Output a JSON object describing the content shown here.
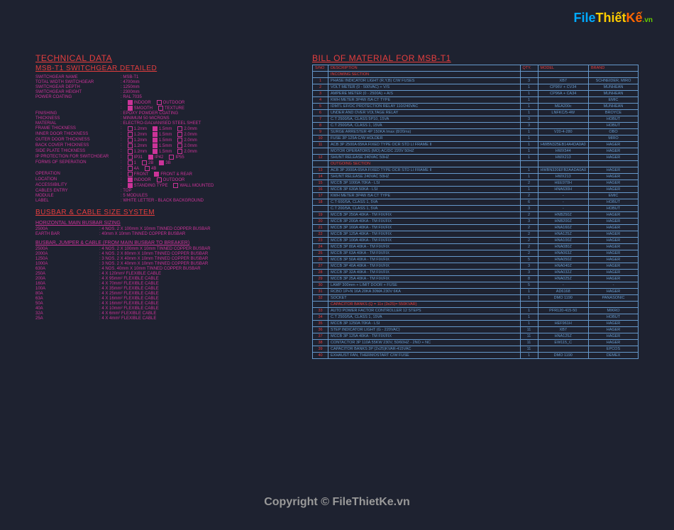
{
  "logo": {
    "part1": "File",
    "part2": "Thiết",
    "part3": "Kế",
    "suffix": ".vn"
  },
  "watermark": "Copyright © FileThietKe.vn",
  "left": {
    "h1": "TECHNICAL DATA",
    "h2": "MSB-T1 SWITCHGEAR DETAILED",
    "specs": [
      {
        "label": "SWITCHGEAR NAME",
        "value": ": MSB-T1"
      },
      {
        "label": "TOTAL WIDTH SWITCHGEAR",
        "value": ": 4700mm"
      },
      {
        "label": "SWITCHGEAR DEPTH",
        "value": ": 1250mm"
      },
      {
        "label": "SWITCHGEAR HEIGHT",
        "value": ": 2300mm"
      },
      {
        "label": "POWER COATING",
        "value": ": RAL 7035"
      }
    ],
    "finishing_label": "FINISHING",
    "finishing_value": ": EPOXY POWDER COATING",
    "thickness_label": "THICKNESS",
    "thickness_value": ": MINIMUM 50 MICRONS",
    "material_label": "MATERIAL",
    "material_value": ": ELECTRO-GALVANISED STEEL SHEET",
    "thickspec": [
      {
        "label": "FRAME THICKNESS",
        "opts": [
          "1.2mm",
          "1.5mm",
          "2.0mm"
        ]
      },
      {
        "label": "INNER DOOR THICKNESS",
        "opts": [
          "1.2mm",
          "1.5mm",
          "2.0mm"
        ]
      },
      {
        "label": "OUTER DOOR THICKNESS",
        "opts": [
          "1.2mm",
          "1.5mm",
          "2.0mm"
        ]
      },
      {
        "label": "BACK COVER THICKNESS",
        "opts": [
          "1.2mm",
          "1.5mm",
          "2.0mm"
        ]
      },
      {
        "label": "SIDE PLATE THICKNESS",
        "opts": [
          "1.2mm",
          "1.5mm",
          "2.0mm"
        ]
      }
    ],
    "ip_label": "IP PROTECTION FOR SWITCHGEAR",
    "ip_opts": [
      "IP31",
      "IP42",
      "IP55"
    ],
    "forms_label": "FORMS OF SEPERATION",
    "forms_opts1": [
      "1",
      "2B",
      "3B"
    ],
    "forms_opts2": [
      "4A",
      "4B"
    ],
    "operation_label": "OPERATION",
    "operation_opts": [
      "FRONT",
      "FRONT & REAR"
    ],
    "location_label": "LOCATION",
    "location_opts": [
      "INDOOR",
      "OUTDOOR"
    ],
    "loc2_opts": [
      "SMOOTH",
      "TEXTURE"
    ],
    "access_label": "ACCESSIBILITY",
    "access_opts": [
      "STANDING TYPE",
      "WALL MOUNTED"
    ],
    "cables_label": "CABLES ENTRY",
    "cables_value": ": TOP",
    "module_label": "MODULE",
    "module_value": ": 5 MODULES",
    "label_label": "LABEL",
    "label_value": ": WHITE LETTER - BLACK BACKGROUND",
    "busbar_h": "BUSBAR & CABLE SIZE SYSTEM",
    "busbar_sub1": "HORIZONTAL MAIN BUSBAR SIZING",
    "hmbs": [
      {
        "k": "2500A",
        "v": ": 4 NOS. 2 X 100mm X 10mm TINNED COPPER BUSBAR"
      },
      {
        "k": "EARTH BAR",
        "v": ": 40mm X 10mm TINNED COPPER BUSBAR"
      }
    ],
    "busbar_sub2": "BUSBAR, JUMPER & CABLE (FROM MAIN BUSBAR TO BREAKER)",
    "bjc": [
      {
        "k": "2500A",
        "v": ": 4 NOS. 2 X 100mm X 10mm TINNED COPPER BUSBAR"
      },
      {
        "k": "2000A",
        "v": ": 4 NOS. 2 X 80mm X 10mm TINNED COPPER BUSBAR"
      },
      {
        "k": "1250A",
        "v": ": 3 NOS. 2 X 40mm X 10mm TINNED COPPER BUSBAR"
      },
      {
        "k": "1000A",
        "v": ": 3 NOS. 2 X 40mm X 10mm TINNED COPPER BUSBAR"
      },
      {
        "k": "630A",
        "v": ": 4 NOS. 40mm X 10mm TINNED COPPER BUSBAR"
      },
      {
        "k": "250A",
        "v": ": 4 X 120mm² FLEXIBLE CABLE"
      },
      {
        "k": "200A",
        "v": ": 4 X 95mm² FLEXIBLE CABLE"
      },
      {
        "k": "160A",
        "v": ": 4 X 70mm² FLEXIBLE CABLE"
      },
      {
        "k": "100A",
        "v": ": 4 X 35mm² FLEXIBLE CABLE"
      },
      {
        "k": "80A",
        "v": ": 4 X 25mm² FLEXIBLE CABLE"
      },
      {
        "k": "63A",
        "v": ": 4 X 16mm² FLEXIBLE CABLE"
      },
      {
        "k": "50A",
        "v": ": 4 X 16mm² FLEXIBLE CABLE"
      },
      {
        "k": "40A",
        "v": ": 4 X 10mm² FLEXIBLE CABLE"
      },
      {
        "k": "32A",
        "v": ": 4 X 6mm² FLEXIBLE CABLE"
      },
      {
        "k": "25A",
        "v": ": 4 X 4mm² FLEXIBLE CABLE"
      }
    ]
  },
  "right": {
    "h1": "BILL OF MATERIAL FOR MSB-T1",
    "headers": [
      "S/NO",
      "DESCRIPTION",
      "QTY.",
      "MODEL",
      "BRAND"
    ],
    "sections": [
      {
        "name": "INCOMING SECTION",
        "red": true
      },
      {
        "no": "1",
        "desc": "PHASE INDICATOR LIGHT (R,Y,B) C/W FUSES",
        "qty": "3",
        "model": "XB7",
        "brand": "SCHNEIDER, MIRO"
      },
      {
        "no": "2",
        "desc": "VOLT METER (0 - 500VAC) + V/S",
        "qty": "1",
        "model": "CP96V + CV34",
        "brand": "MUNHEAN"
      },
      {
        "no": "3",
        "desc": "AMPERE METER (0 - 2500A) + A/S",
        "qty": "1",
        "model": "CP96A + CA34",
        "brand": "MUNHEAN"
      },
      {
        "no": "4",
        "desc": "KWH METER 3P4W /5A CT TYPE",
        "qty": "1",
        "model": "",
        "brand": "EMIC"
      },
      {
        "no": "5",
        "desc": "IDMTL EF/OC PROTECTION RELAY 110/240VAC",
        "qty": "1",
        "model": "MEA200c",
        "brand": "MUNHEAN"
      },
      {
        "no": "6",
        "desc": "UNDER AND OVER VOLTAGE RELAY",
        "qty": "1",
        "model": "LNFKC/5-4W",
        "brand": "BROYCE"
      },
      {
        "no": "7",
        "desc": "C.T 2500/5A, CLASS 5P10, 15VA",
        "qty": "3",
        "model": "",
        "brand": "HOBUT"
      },
      {
        "no": "8",
        "desc": "C.T 2500/5A, CLASS 1, 15VA",
        "qty": "3",
        "model": "",
        "brand": "HOBUT"
      },
      {
        "no": "9",
        "desc": "SURGE ARRESTER 4P 150KA Imax (8/20ms)",
        "qty": "1",
        "model": "V20-4-280",
        "brand": "OBO"
      },
      {
        "no": "10",
        "desc": "FUSE 3P 125A C/W HOLDER",
        "qty": "1",
        "model": "",
        "brand": "MIRO"
      },
      {
        "no": "11",
        "desc": "ACB 3P 2500A 65KA FIXED TYPE OCR STD LI FRAME II",
        "qty": "1",
        "model": "HWBN325EB14A4DA0A0",
        "brand": "HAGER"
      },
      {
        "no": "",
        "desc": "MOTOR OPERATORS (MO) AC/DC 220V 50HZ",
        "qty": "1",
        "model": "HWX544",
        "brand": "HAGER"
      },
      {
        "no": "12",
        "desc": "SHUNT RELEASE 240VAC 50HZ",
        "qty": "1",
        "model": "HWX213",
        "brand": "HAGER"
      },
      {
        "name": "OUTGOING SECTION",
        "red": true
      },
      {
        "no": "13",
        "desc": "ACB 3P 2000A 65KA FIXED TYPE OCR STD LI FRAME II",
        "qty": "1",
        "model": "HWBN320EFB2AADA0A0",
        "brand": "HAGER"
      },
      {
        "no": "14",
        "desc": "SHUNT RELEASE 240VAC 50HZ",
        "qty": "1",
        "model": "HWX213",
        "brand": "HAGER"
      },
      {
        "no": "15",
        "desc": "MCCB 3P 1000A 70KA - LSI",
        "qty": "2",
        "model": "HEE970H",
        "brand": "HAGER"
      },
      {
        "no": "16",
        "desc": "MCCB 3P 630A 50KA - LSI",
        "qty": "1",
        "model": "HNA630H",
        "brand": "HAGER"
      },
      {
        "no": "17",
        "desc": "KWH METER 3P4W /5A CT TYPE",
        "qty": "2",
        "model": "-",
        "brand": "EMIC"
      },
      {
        "no": "18",
        "desc": "C.T 600/5A, CLASS 1, 5VA",
        "qty": "6",
        "model": "-",
        "brand": "HOBUT"
      },
      {
        "no": "",
        "desc": "C.T 200/5A, CLASS 1, 5VA",
        "qty": "3",
        "model": "-",
        "brand": "HOBUT"
      },
      {
        "no": "19",
        "desc": "MCCB 3P 250A 40KA - TM FIX/FIX",
        "qty": "2",
        "model": "HNB250Z",
        "brand": "HAGER"
      },
      {
        "no": "20",
        "desc": "MCCB 3P 200A 40KA - TM FIX/FIX",
        "qty": "3",
        "model": "HNB200Z",
        "brand": "HAGER"
      },
      {
        "no": "21",
        "desc": "MCCB 3P 160A 40KA - TM FIX/FIX",
        "qty": "2",
        "model": "HNA160Z",
        "brand": "HAGER"
      },
      {
        "no": "22",
        "desc": "MCCB 3P 125A 40KA - TM FIX/FIX",
        "qty": "2",
        "model": "HNA125Z",
        "brand": "HAGER"
      },
      {
        "no": "23",
        "desc": "MCCB 3P 100A 40KA - TM FIX/FIX",
        "qty": "2",
        "model": "HNA100Z",
        "brand": "HAGER"
      },
      {
        "no": "24",
        "desc": "MCCB 3P 80A 40KA - TM FIX/FIX",
        "qty": "2",
        "model": "HNA080Z",
        "brand": "HAGER"
      },
      {
        "no": "25",
        "desc": "MCCB 3P 63A 40KA - TM FIX/FIX",
        "qty": "2",
        "model": "HNA063Z",
        "brand": "HAGER"
      },
      {
        "no": "26",
        "desc": "MCCB 3P 50A 40KA - TM FIX/FIX",
        "qty": "5",
        "model": "HNA050Z",
        "brand": "HAGER"
      },
      {
        "no": "27",
        "desc": "MCCB 3P 40A 40KA - TM FIX/FIX",
        "qty": "3",
        "model": "HNA040Z",
        "brand": "HAGER"
      },
      {
        "no": "28",
        "desc": "MCCB 3P 32A 40KA - TM FIX/FIX",
        "qty": "3",
        "model": "HNA032Z",
        "brand": "HAGER"
      },
      {
        "no": "29",
        "desc": "MCCB 3P 25A 40KA - TM FIX/FIX",
        "qty": "8",
        "model": "HNA025Z",
        "brand": "HAGER"
      },
      {
        "no": "30",
        "desc": "LAMP 300mm + LIMIT DOOR + FUSE",
        "qty": "5",
        "model": "-",
        "brand": "-"
      },
      {
        "no": "31",
        "desc": "RCBO 1P+N 16A 20KA 30MA 230V 6KA",
        "qty": "1",
        "model": "AD6168",
        "brand": "HAGER"
      },
      {
        "no": "32",
        "desc": "SOCKET",
        "qty": "1",
        "model": "DMO 1190",
        "brand": "PANASONIC"
      },
      {
        "name": "CAPACITOR BANKS (Q = 11x (3x25)= 550KVAR)",
        "red": true
      },
      {
        "no": "33",
        "desc": "AUTO POWER FACTOR CONTROLLER 12 STEPS",
        "qty": "1",
        "model": "PFR120-415-50",
        "brand": "MIKRO"
      },
      {
        "no": "34",
        "desc": "C.T 2500/5A, CLASS 1, 15VA",
        "qty": "1",
        "model": "",
        "brand": "HOBUT"
      },
      {
        "no": "35",
        "desc": "MCCB 3P 1250A 70KA - LSI",
        "qty": "1",
        "model": "HEF961H",
        "brand": "HAGER"
      },
      {
        "no": "36",
        "desc": "STEP INDICATOR LIGHT (G - 220VAC)",
        "qty": "11",
        "model": "XB7",
        "brand": "HAGER"
      },
      {
        "no": "37",
        "desc": "MCCB 3P 125A 40KA - TM FIX/FIX",
        "qty": "11",
        "model": "HNA125Z",
        "brand": "HAGER"
      },
      {
        "no": "38",
        "desc": "CONTACTOR 3P 110A 55KW 230V, 50/60HZ - 2NO + NC",
        "qty": "11",
        "model": "EW115_C",
        "brand": "HAGER"
      },
      {
        "no": "39",
        "desc": "CAPACITOR BANKS 3P (2x25)KVAR-415VAC",
        "qty": "11",
        "model": "",
        "brand": "EPCOS"
      },
      {
        "no": "40",
        "desc": "EXHAUST FAN, THERMOSTART C/W FUSE",
        "qty": "1",
        "model": "DMO 1190",
        "brand": "DEMEX"
      }
    ]
  }
}
